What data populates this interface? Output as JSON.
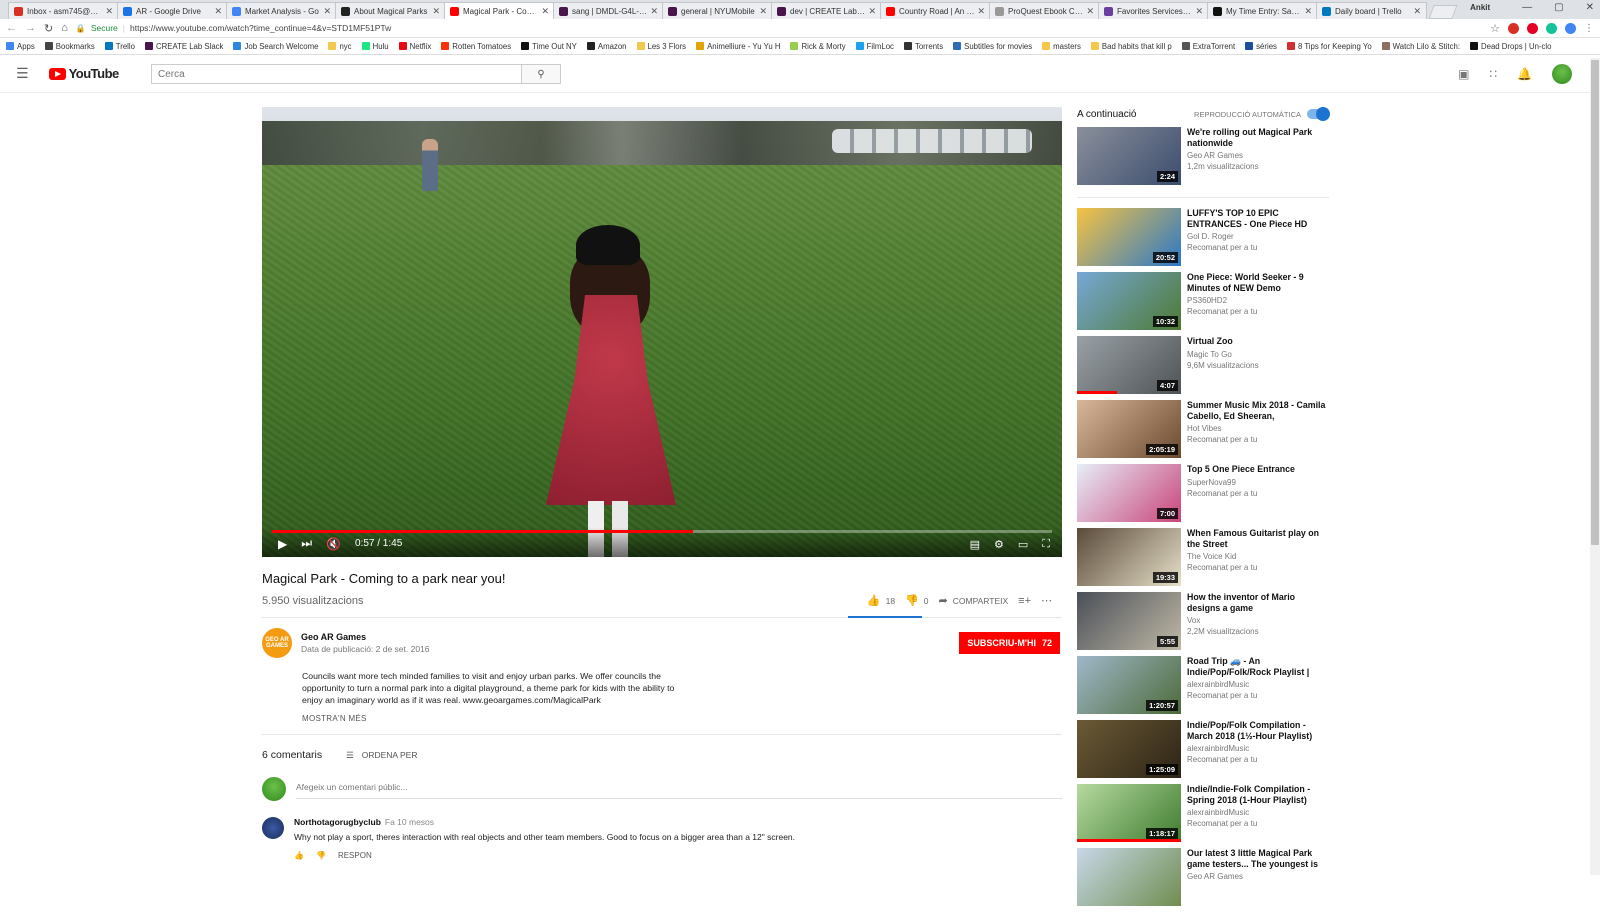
{
  "browser": {
    "tabs": [
      {
        "label": "Inbox - asm745@nyu",
        "color": "#d93025"
      },
      {
        "label": "AR - Google Drive",
        "color": "#1a73e8"
      },
      {
        "label": "Market Analysis - Go",
        "color": "#4285f4"
      },
      {
        "label": "About Magical Parks",
        "color": "#222222"
      },
      {
        "label": "Magical Park - Comin",
        "color": "#ff0000",
        "active": true
      },
      {
        "label": "sang | DMDL-G4L-Th",
        "color": "#4a154b"
      },
      {
        "label": "general | NYUMobile",
        "color": "#4a154b"
      },
      {
        "label": "dev | CREATE Lab Slac",
        "color": "#4a154b"
      },
      {
        "label": "Country Road | An Inc",
        "color": "#ff0000"
      },
      {
        "label": "ProQuest Ebook Cent",
        "color": "#999999"
      },
      {
        "label": "Favorites Services - N",
        "color": "#6a3fa0"
      },
      {
        "label": "My Time Entry: Saurin",
        "color": "#111111"
      },
      {
        "label": "Daily board | Trello",
        "color": "#0079bf"
      }
    ],
    "user_name": "Ankit",
    "secure_label": "Secure",
    "url": "https://www.youtube.com/watch?time_continue=4&v=STD1MF51PTw",
    "bookmarks": [
      {
        "label": "Apps",
        "color": "#4285f4"
      },
      {
        "label": "Bookmarks",
        "color": "#444444"
      },
      {
        "label": "Trello",
        "color": "#0079bf"
      },
      {
        "label": "CREATE Lab Slack",
        "color": "#4a154b"
      },
      {
        "label": "Job Search Welcome",
        "color": "#2e86de"
      },
      {
        "label": "nyc",
        "folder": true
      },
      {
        "label": "Hulu",
        "color": "#1ce783"
      },
      {
        "label": "Netflix",
        "color": "#e50914"
      },
      {
        "label": "Rotten Tomatoes",
        "color": "#fa320a"
      },
      {
        "label": "Time Out NY",
        "color": "#111111"
      },
      {
        "label": "Amazon",
        "color": "#222222"
      },
      {
        "label": "Les 3 Flors",
        "folder": true
      },
      {
        "label": "Animelliure - Yu Yu H",
        "color": "#e1a400"
      },
      {
        "label": "Rick & Morty",
        "color": "#97ce4c"
      },
      {
        "label": "FilmLoc",
        "color": "#1da1f2"
      },
      {
        "label": "Torrents",
        "color": "#333333"
      },
      {
        "label": "Subtitles for movies",
        "color": "#2c6db5"
      },
      {
        "label": "masters",
        "folder": true
      },
      {
        "label": "Bad habits that kill p",
        "folder": true
      },
      {
        "label": "ExtraTorrent",
        "color": "#555555"
      },
      {
        "label": "séries",
        "color": "#1a4fa0"
      },
      {
        "label": "8 Tips for Keeping Yo",
        "color": "#d32f2f"
      },
      {
        "label": "Watch Lilo & Stitch:",
        "color": "#8d6e63"
      },
      {
        "label": "Dead Drops | Un-clo",
        "color": "#111111"
      }
    ]
  },
  "youtube": {
    "logo_text": "YouTube",
    "search_placeholder": "Cerca"
  },
  "video": {
    "time": "0:57 / 1:45",
    "progress": 0.54,
    "buffered": 0.54,
    "title": "Magical Park - Coming to a park near you!",
    "views": "5.950 visualitzacions",
    "likes": "18",
    "dislikes": "0",
    "share_label": "COMPARTEIX"
  },
  "channel": {
    "name": "Geo AR Games",
    "avatar_text": "GEO AR GAMES",
    "date": "Data de publicació: 2 de set. 2016",
    "subscribe_label": "SUBSCRIU-M'HI",
    "subscribers": "72",
    "description": "Councils want more tech minded families to visit and enjoy urban parks. We offer councils the opportunity to turn a normal park into a digital playground, a theme park for kids with the ability to enjoy an imaginary world as if it was real. www.geoargames.com/MagicalPark",
    "show_more": "MOSTRA'N MÉS"
  },
  "comments": {
    "count_label": "6 comentaris",
    "sort_label": "ORDENA PER",
    "add_placeholder": "Afegeix un comentari públic...",
    "items": [
      {
        "author": "Northotagorugbyclub",
        "time": "Fa 10 mesos",
        "text": "Why not play a sport, theres interaction with real objects and other team members. Good to focus on a bigger area than a 12\" screen.",
        "reply_label": "RESPON"
      }
    ]
  },
  "sidebar": {
    "up_next_label": "A continuació",
    "autoplay_label": "REPRODUCCIÓ AUTOMÀTICA",
    "videos": [
      {
        "title": "We're rolling out Magical Park nationwide",
        "channel": "Geo AR Games",
        "meta": "1,2m visualitzacions",
        "duration": "2:24",
        "thumb": [
          "#8a8f9a",
          "#3b4d6e"
        ]
      },
      {
        "title": "LUFFY'S TOP 10 EPIC ENTRANCES - One Piece HD",
        "channel": "Gol D. Roger",
        "meta": "Recomanat per a tu",
        "duration": "20:52",
        "thumb": [
          "#f6c342",
          "#2a78c9"
        ]
      },
      {
        "title": "One Piece: World Seeker - 9 Minutes of NEW Demo",
        "channel": "PS360HD2",
        "meta": "Recomanat per a tu",
        "duration": "10:32",
        "thumb": [
          "#76a8d6",
          "#4e7a33"
        ]
      },
      {
        "title": "Virtual Zoo",
        "channel": "Magic To Go",
        "meta": "9,6M visualitzacions",
        "duration": "4:07",
        "thumb": [
          "#9aa1a6",
          "#4e5356"
        ],
        "watched": 0.38
      },
      {
        "title": "Summer Music Mix 2018 - Camila Cabello, Ed Sheeran,",
        "channel": "Hot Vibes",
        "meta": "Recomanat per a tu",
        "duration": "2:05:19",
        "thumb": [
          "#d8b79a",
          "#6b4a2f"
        ]
      },
      {
        "title": "Top 5 One Piece Entrance",
        "channel": "SuperNova99",
        "meta": "Recomanat per a tu",
        "duration": "7:00",
        "thumb": [
          "#e6eef8",
          "#c9457a"
        ]
      },
      {
        "title": "When Famous Guitarist play on the Street",
        "channel": "The Voice Kid",
        "meta": "Recomanat per a tu",
        "duration": "19:33",
        "thumb": [
          "#5a4a3a",
          "#e6e0c8"
        ]
      },
      {
        "title": "How the inventor of Mario designs a game",
        "channel": "Vox",
        "meta": "2,2M visualitzacions",
        "duration": "5:55",
        "thumb": [
          "#4a4f58",
          "#c0b9a6"
        ]
      },
      {
        "title": "Road Trip 🚙 - An Indie/Pop/Folk/Rock Playlist |",
        "channel": "alexrainbirdMusic",
        "meta": "Recomanat per a tu",
        "duration": "1:20:57",
        "thumb": [
          "#9fb7c9",
          "#4d6b3a"
        ]
      },
      {
        "title": "Indie/Pop/Folk Compilation - March 2018 (1½-Hour Playlist)",
        "channel": "alexrainbirdMusic",
        "meta": "Recomanat per a tu",
        "duration": "1:25:09",
        "thumb": [
          "#6b5a35",
          "#2d2416"
        ]
      },
      {
        "title": "Indie/Indie-Folk Compilation - Spring 2018 (1-Hour Playlist)",
        "channel": "alexrainbirdMusic",
        "meta": "Recomanat per a tu",
        "duration": "1:18:17",
        "thumb": [
          "#b6d9a0",
          "#3f7d2f"
        ],
        "watched": 1.0
      },
      {
        "title": "Our latest 3 little Magical Park game testers... The youngest is",
        "channel": "Geo AR Games",
        "meta": "",
        "duration": "",
        "thumb": [
          "#c8d8e8",
          "#6f8d4f"
        ]
      }
    ]
  },
  "colors": {
    "brand": "#ff0000",
    "accent": "#1e73d1"
  }
}
